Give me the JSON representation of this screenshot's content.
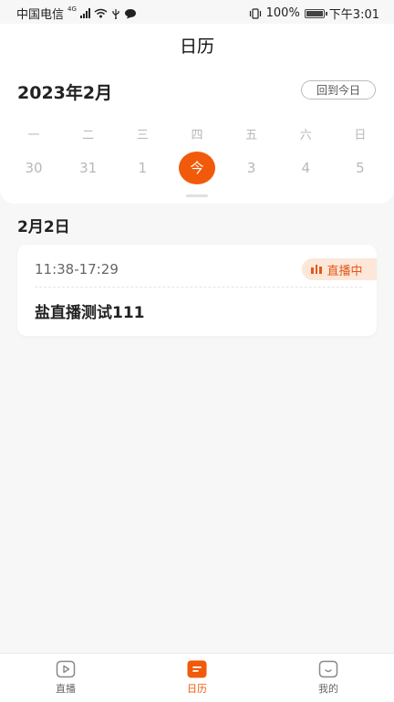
{
  "status_bar": {
    "carrier": "中国电信",
    "network": "4G",
    "battery": "100%",
    "time": "下午3:01"
  },
  "header": {
    "title": "日历"
  },
  "calendar": {
    "month_label": "2023年2月",
    "today_button": "回到今日",
    "weekdays": [
      "一",
      "二",
      "三",
      "四",
      "五",
      "六",
      "日"
    ],
    "dates": [
      "30",
      "31",
      "1",
      "今",
      "3",
      "4",
      "5"
    ],
    "selected_index": 3
  },
  "date_heading": "2月2日",
  "event": {
    "time": "11:38-17:29",
    "badge": "直播中",
    "title": "盐直播测试111"
  },
  "nav": {
    "items": [
      {
        "label": "直播",
        "icon": "live-play-icon"
      },
      {
        "label": "日历",
        "icon": "calendar-icon"
      },
      {
        "label": "我的",
        "icon": "profile-icon"
      }
    ],
    "active_index": 1
  },
  "colors": {
    "accent": "#f15a0a",
    "badge_bg": "#fde7d9",
    "background": "#f7f7f7"
  }
}
